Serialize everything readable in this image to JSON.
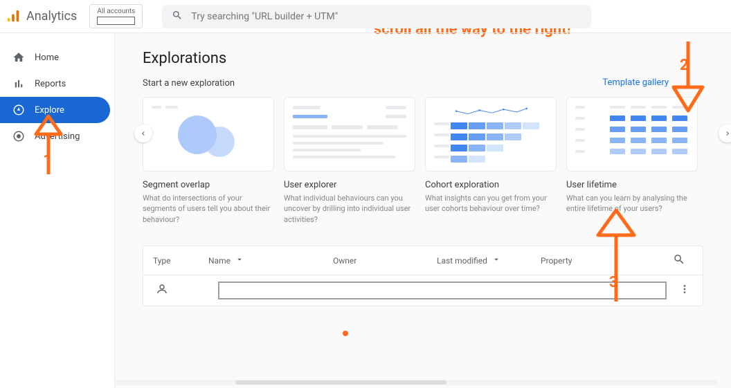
{
  "header": {
    "app_name": "Analytics",
    "account_label": "All accounts",
    "search_placeholder": "Try searching \"URL builder + UTM\""
  },
  "sidebar": {
    "items": [
      {
        "label": "Home"
      },
      {
        "label": "Reports"
      },
      {
        "label": "Explore"
      },
      {
        "label": "Advertising"
      }
    ]
  },
  "main": {
    "title": "Explorations",
    "subhead": "Start a new exploration",
    "gallery_link": "Template gallery"
  },
  "cards": [
    {
      "title": "Segment overlap",
      "desc": "What do intersections of your segments of users tell you about their behaviour?"
    },
    {
      "title": "User explorer",
      "desc": "What individual behaviours can you uncover by drilling into individual user activities?"
    },
    {
      "title": "Cohort exploration",
      "desc": "What insights can you get from your user cohorts behaviour over time?"
    },
    {
      "title": "User lifetime",
      "desc": "What can you learn by analysing the entire lifetime of your users?"
    }
  ],
  "table": {
    "columns": {
      "type": "Type",
      "name": "Name",
      "owner": "Owner",
      "last_modified": "Last modified",
      "property": "Property"
    }
  },
  "annotations": {
    "scroll_hint": "scroll all the way to the right!",
    "n1": "1",
    "n2": "2",
    "n3": "3"
  }
}
